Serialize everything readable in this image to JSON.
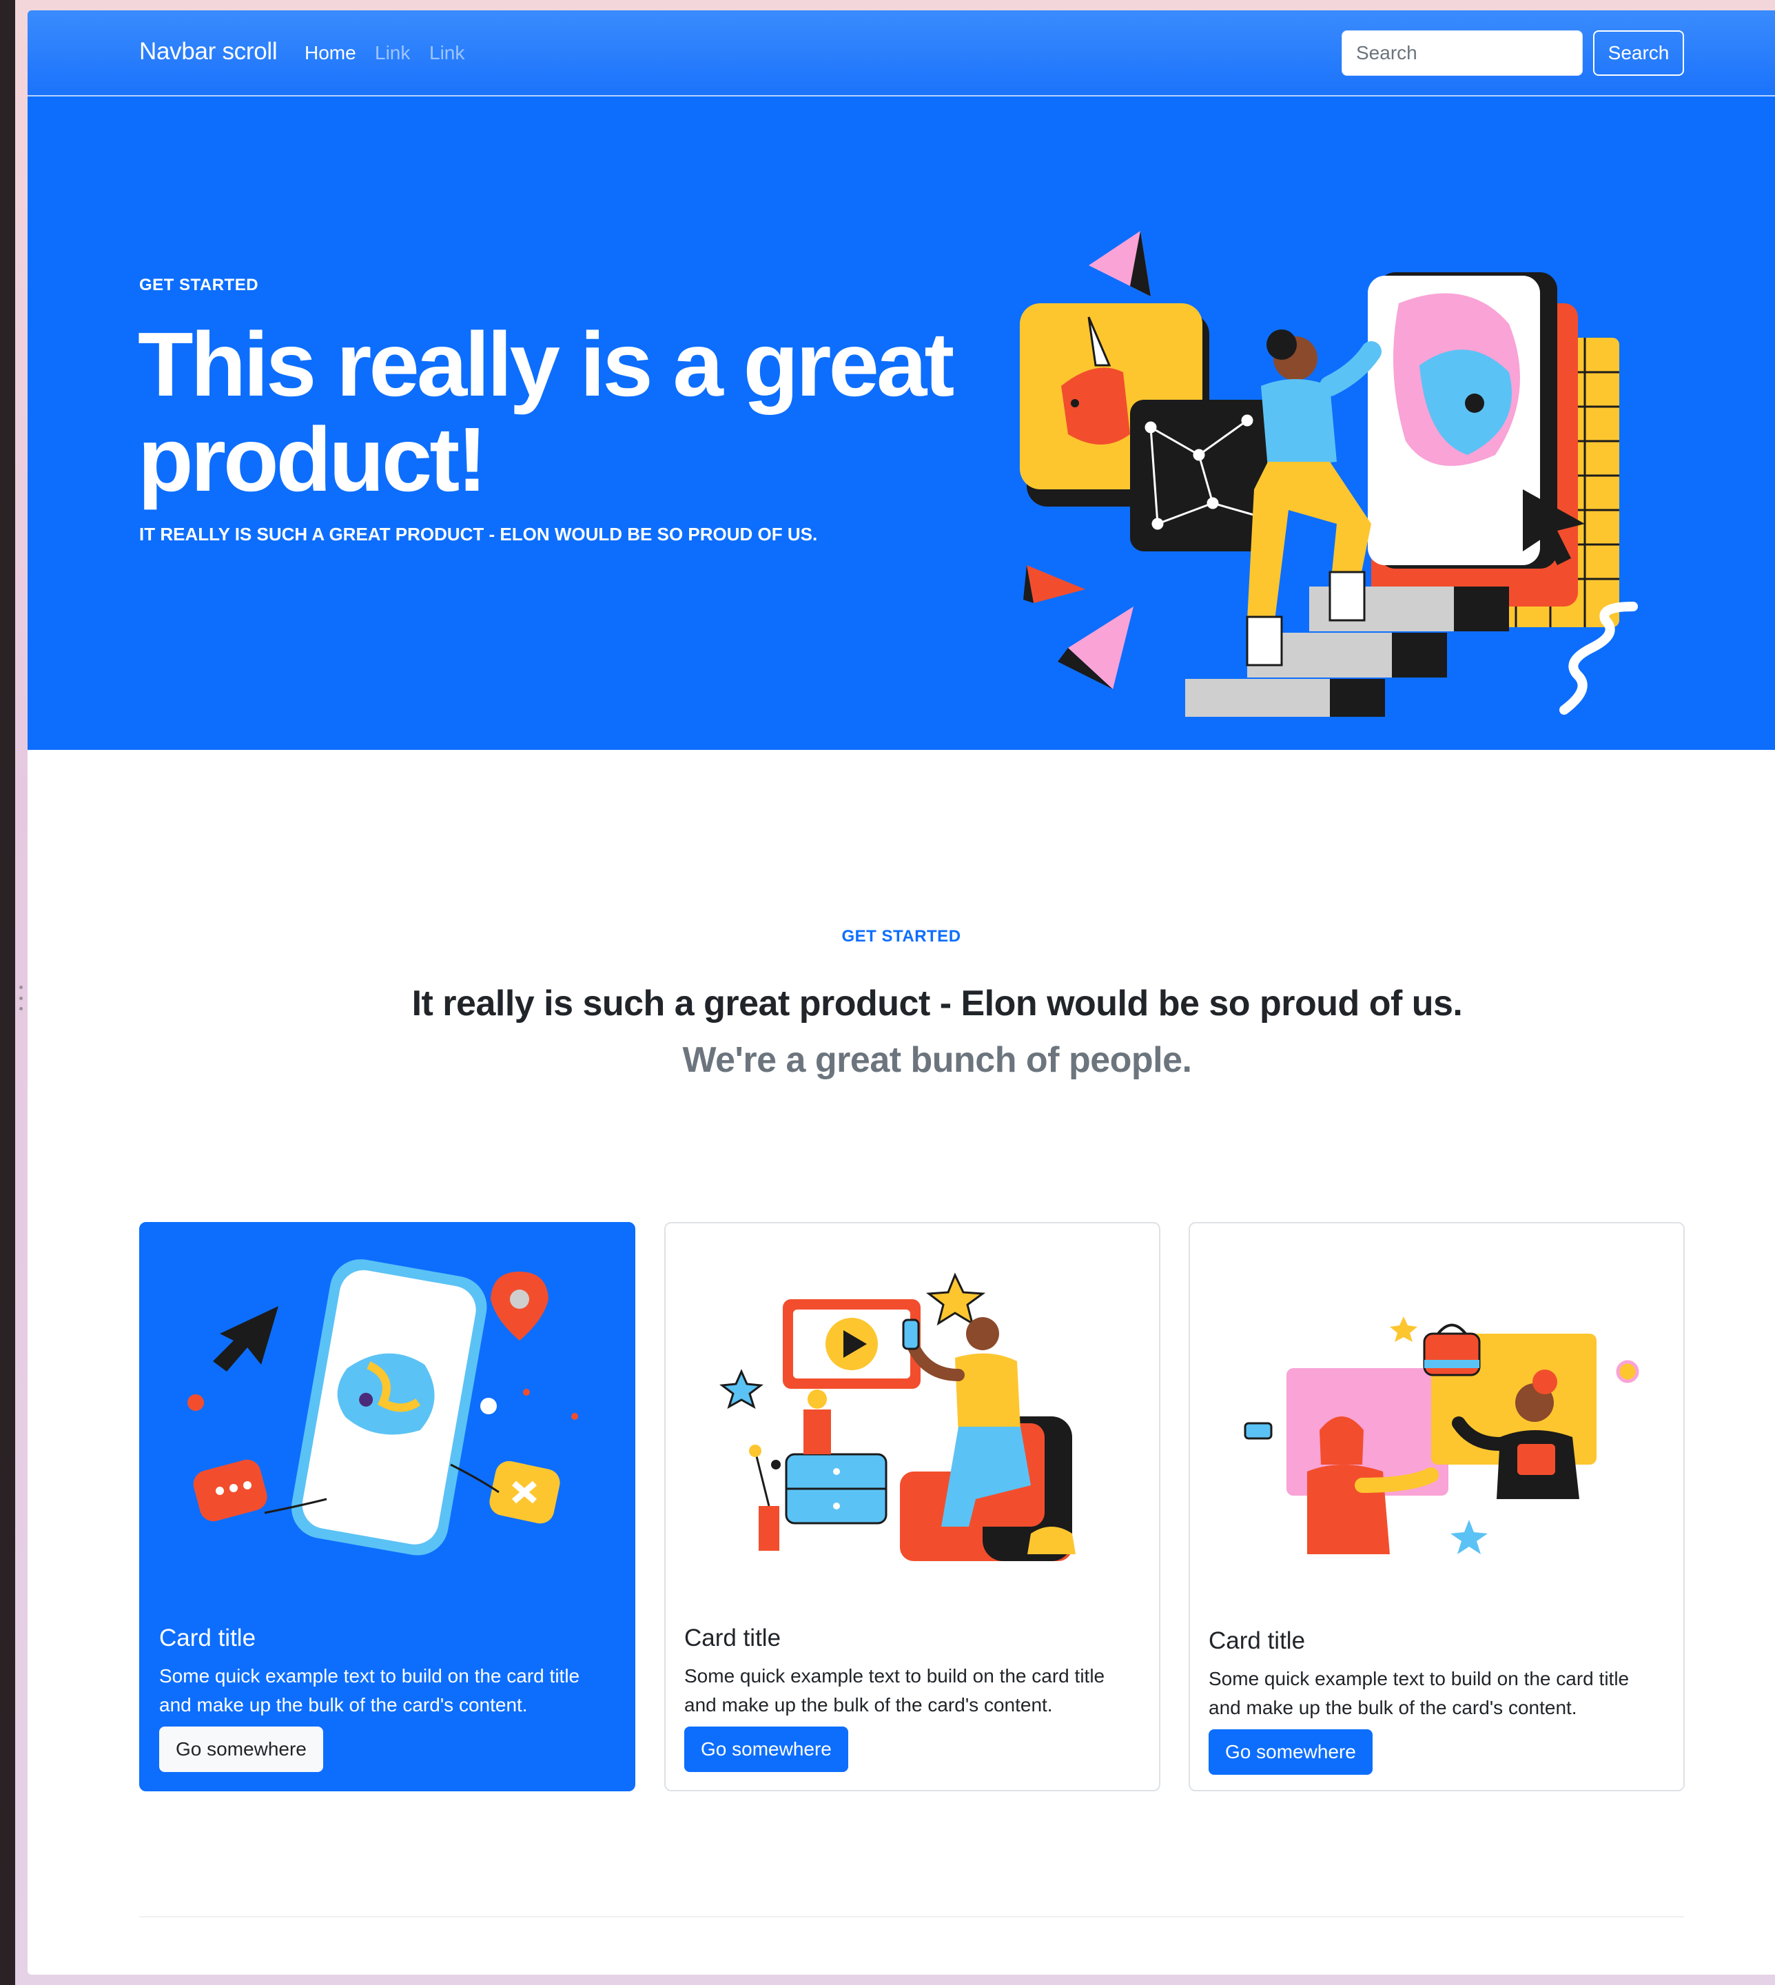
{
  "navbar": {
    "brand": "Navbar scroll",
    "links": [
      "Home",
      "Link",
      "Link"
    ],
    "search_placeholder": "Search",
    "search_button": "Search"
  },
  "hero": {
    "eyebrow": "GET STARTED",
    "title": "This really is a great product!",
    "subtitle": "IT REALLY IS SUCH A GREAT PRODUCT - ELON WOULD BE SO PROUD OF US."
  },
  "section": {
    "eyebrow": "GET STARTED",
    "lead": "It really is such a great product - Elon would be so proud of us.",
    "lead_muted": "We're a great bunch of people."
  },
  "cards": [
    {
      "title": "Card title",
      "text": "Some quick example text to build on the card title and make up the bulk of the card's content.",
      "button": "Go somewhere"
    },
    {
      "title": "Card title",
      "text": "Some quick example text to build on the card title and make up the bulk of the card's content.",
      "button": "Go somewhere"
    },
    {
      "title": "Card title",
      "text": "Some quick example text to build on the card title and make up the bulk of the card's content.",
      "button": "Go somewhere"
    }
  ],
  "colors": {
    "primary": "#0d6efd",
    "muted": "#6c757d",
    "dark": "#212529"
  }
}
